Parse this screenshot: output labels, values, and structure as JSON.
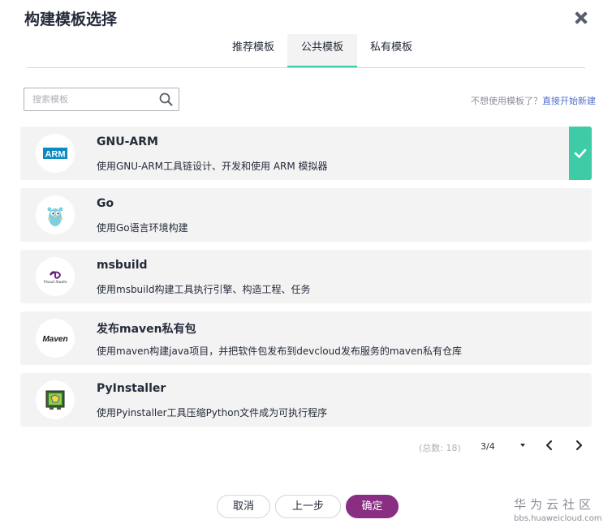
{
  "dialog": {
    "title": "构建模板选择"
  },
  "tabs": [
    {
      "label": "推荐模板",
      "active": false
    },
    {
      "label": "公共模板",
      "active": true
    },
    {
      "label": "私有模板",
      "active": false
    }
  ],
  "search": {
    "placeholder": "搜索模板",
    "value": ""
  },
  "hint": {
    "question": "不想使用模板了？",
    "link": "直接开始新建"
  },
  "templates": [
    {
      "name": "GNU-ARM",
      "desc": "使用GNU-ARM工具链设计、开发和使用 ARM 模拟器",
      "icon": "arm-logo-icon",
      "logo_text": "ARM",
      "selected": true
    },
    {
      "name": "Go",
      "desc": "使用Go语言环境构建",
      "icon": "go-gopher-icon",
      "selected": false
    },
    {
      "name": "msbuild",
      "desc": "使用msbuild构建工具执行引擎、构造工程、任务",
      "icon": "visual-studio-icon",
      "logo_text": "Visual Studio",
      "selected": false
    },
    {
      "name": "发布maven私有包",
      "desc": "使用maven构建java项目，并把软件包发布到devcloud发布服务的maven私有仓库",
      "icon": "maven-logo-icon",
      "logo_text": "Maven",
      "selected": false
    },
    {
      "name": "PyInstaller",
      "desc": "使用Pyinstaller工具压缩Python文件成为可执行程序",
      "icon": "pyinstaller-icon",
      "selected": false
    }
  ],
  "pagination": {
    "total_label": "(总数:  18)",
    "page_label": "3/4"
  },
  "buttons": {
    "cancel": "取消",
    "back": "上一步",
    "confirm": "确定"
  },
  "watermark": {
    "name": "华为云社区",
    "url": "bbs.huaweicloud.com"
  },
  "colors": {
    "accent": "#3dcca6",
    "primary": "#8a2e83",
    "link": "#526ecc",
    "card_bg": "#f3f3f3",
    "arm_blue": "#0a8bc2"
  }
}
